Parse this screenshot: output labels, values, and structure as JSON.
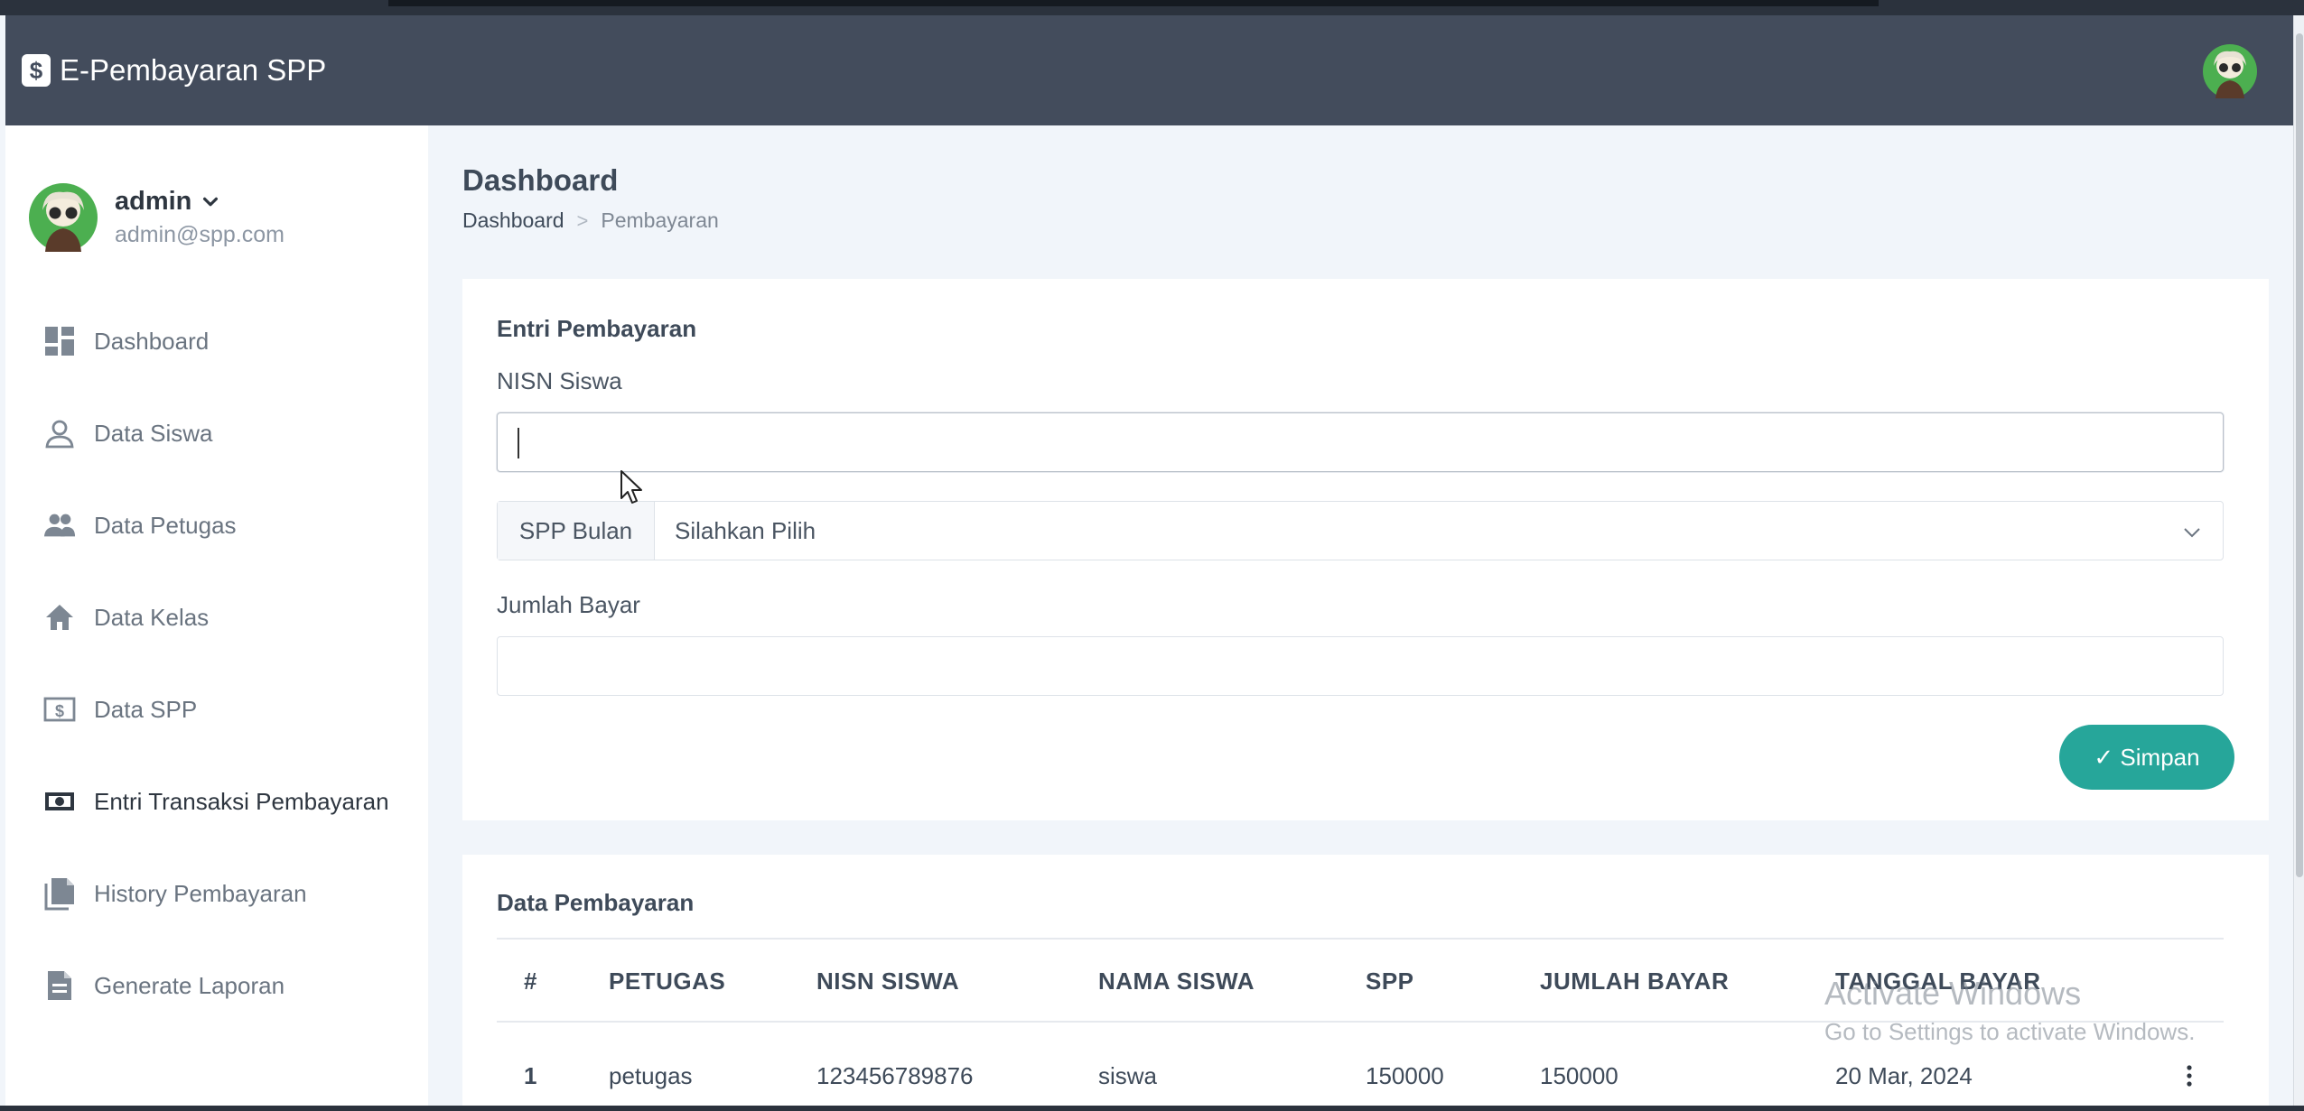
{
  "app": {
    "brand_symbol": "$",
    "brand_name": "E-Pembayaran SPP"
  },
  "user": {
    "name": "admin",
    "email": "admin@spp.com"
  },
  "sidebar": {
    "items": [
      {
        "label": "Dashboard",
        "icon": "dashboard-icon"
      },
      {
        "label": "Data Siswa",
        "icon": "person-icon"
      },
      {
        "label": "Data Petugas",
        "icon": "people-icon"
      },
      {
        "label": "Data Kelas",
        "icon": "home-icon"
      },
      {
        "label": "Data SPP",
        "icon": "dollar-icon"
      },
      {
        "label": "Entri Transaksi Pembayaran",
        "icon": "cash-icon",
        "active": true
      },
      {
        "label": "History Pembayaran",
        "icon": "files-icon"
      },
      {
        "label": "Generate Laporan",
        "icon": "document-icon"
      }
    ]
  },
  "page": {
    "title": "Dashboard",
    "breadcrumb": {
      "home": "Dashboard",
      "separator": ">",
      "current": "Pembayaran"
    }
  },
  "form": {
    "title": "Entri Pembayaran",
    "nisn_label": "NISN Siswa",
    "nisn_value": "",
    "spp_addon": "SPP Bulan",
    "spp_selected": "Silahkan Pilih",
    "jumlah_label": "Jumlah Bayar",
    "jumlah_value": "",
    "save_label": "✓ Simpan"
  },
  "table": {
    "title": "Data Pembayaran",
    "columns": [
      "#",
      "PETUGAS",
      "NISN SISWA",
      "NAMA SISWA",
      "SPP",
      "JUMLAH BAYAR",
      "TANGGAL BAYAR"
    ],
    "rows": [
      {
        "no": "1",
        "petugas": "petugas",
        "nisn": "123456789876",
        "nama": "siswa",
        "spp": "150000",
        "jumlah": "150000",
        "tanggal": "20 Mar, 2024"
      }
    ]
  },
  "watermark": {
    "title": "Activate Windows",
    "subtitle": "Go to Settings to activate Windows."
  },
  "colors": {
    "navbar": "#434c5c",
    "accent": "#26a69a",
    "background": "#f1f5fa"
  }
}
